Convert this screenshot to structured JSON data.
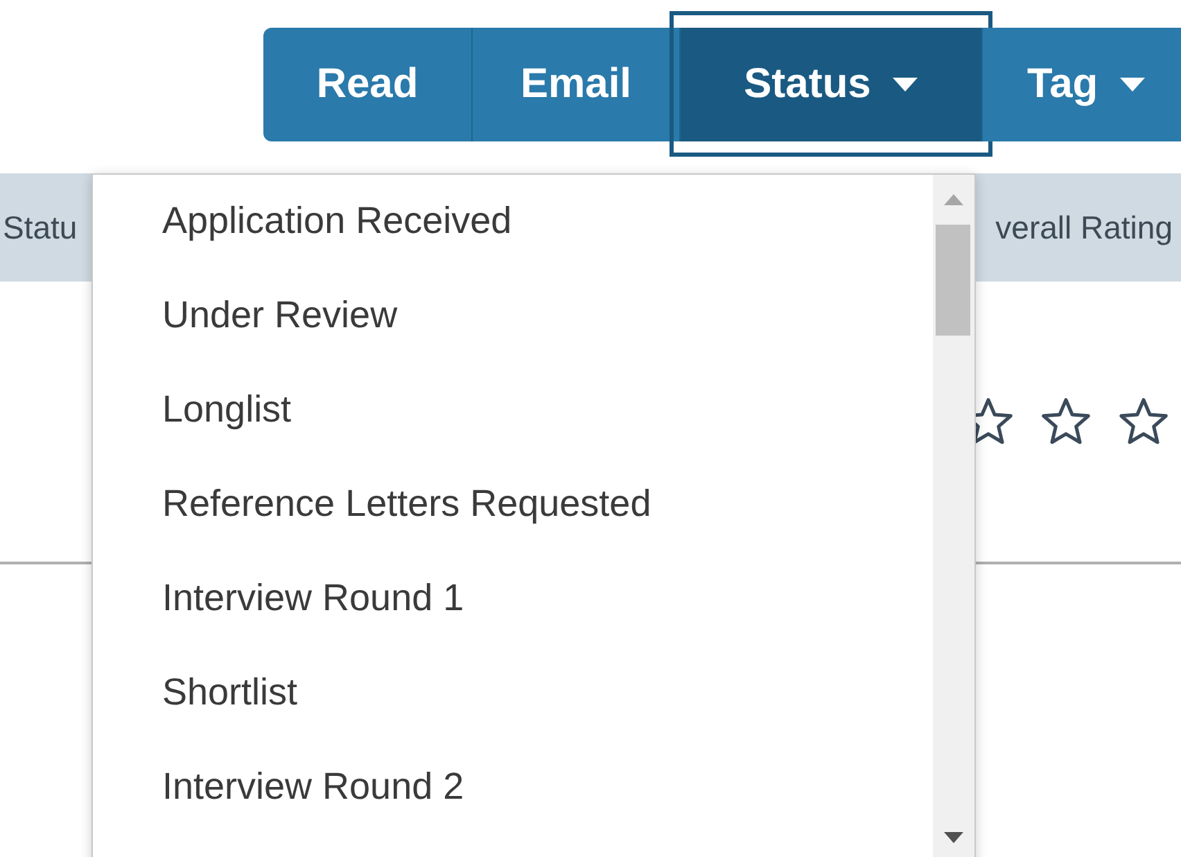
{
  "toolbar": {
    "buttons": [
      {
        "label": "Read",
        "kind": "plain",
        "selected": false
      },
      {
        "label": "Email",
        "kind": "plain",
        "selected": false
      },
      {
        "label": "Status",
        "kind": "dropdown",
        "selected": true
      },
      {
        "label": "Tag",
        "kind": "dropdown",
        "selected": false
      }
    ]
  },
  "table": {
    "columns": [
      "Statu",
      "verall Rating"
    ],
    "rows": [
      {
        "stars": 0
      }
    ]
  },
  "status_menu": {
    "items": [
      "Application Received",
      "Under Review",
      "Longlist",
      "Reference Letters Requested",
      "Interview Round 1",
      "Shortlist",
      "Interview Round 2"
    ]
  }
}
